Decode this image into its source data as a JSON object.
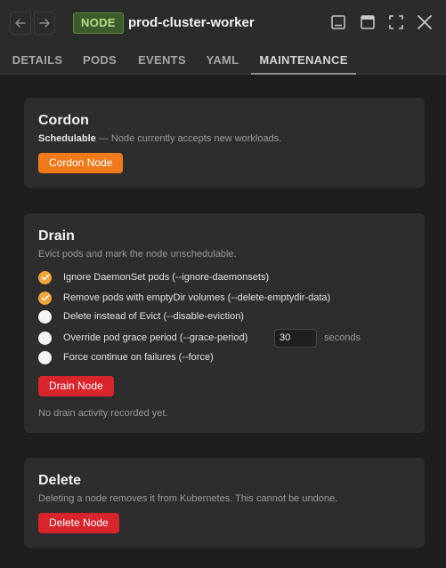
{
  "header": {
    "kind": "NODE",
    "name": "prod-cluster-worker"
  },
  "tabs": [
    {
      "label": "DETAILS"
    },
    {
      "label": "PODS"
    },
    {
      "label": "EVENTS"
    },
    {
      "label": "YAML"
    },
    {
      "label": "MAINTENANCE",
      "active": true
    }
  ],
  "cordon": {
    "title": "Cordon",
    "status": "Schedulable",
    "status_desc": " — Node currently accepts new workloads.",
    "button": "Cordon Node"
  },
  "drain": {
    "title": "Drain",
    "desc": "Evict pods and mark the node unschedulable.",
    "options": [
      {
        "label": "Ignore DaemonSet pods (--ignore-daemonsets)",
        "checked": true
      },
      {
        "label": "Remove pods with emptyDir volumes (--delete-emptydir-data)",
        "checked": true
      },
      {
        "label": "Delete instead of Evict (--disable-eviction)",
        "checked": false
      },
      {
        "label": "Override pod grace period (--grace-period)",
        "checked": false
      },
      {
        "label": "Force continue on failures (--force)",
        "checked": false
      }
    ],
    "grace_value": "30",
    "grace_unit": "seconds",
    "button": "Drain Node",
    "status": "No drain activity recorded yet."
  },
  "delete": {
    "title": "Delete",
    "desc": "Deleting a node removes it from Kubernetes. This cannot be undone.",
    "button": "Delete Node"
  },
  "colors": {
    "accent_orange": "#f07a1a",
    "danger_red": "#d8252c",
    "checkbox_on": "#f1a43a",
    "badge_green": "#3c5c2c"
  },
  "icons": [
    "arrow-left-icon",
    "arrow-right-icon",
    "dock-bottom-icon",
    "window-icon",
    "fullscreen-icon",
    "close-icon",
    "check-icon"
  ]
}
